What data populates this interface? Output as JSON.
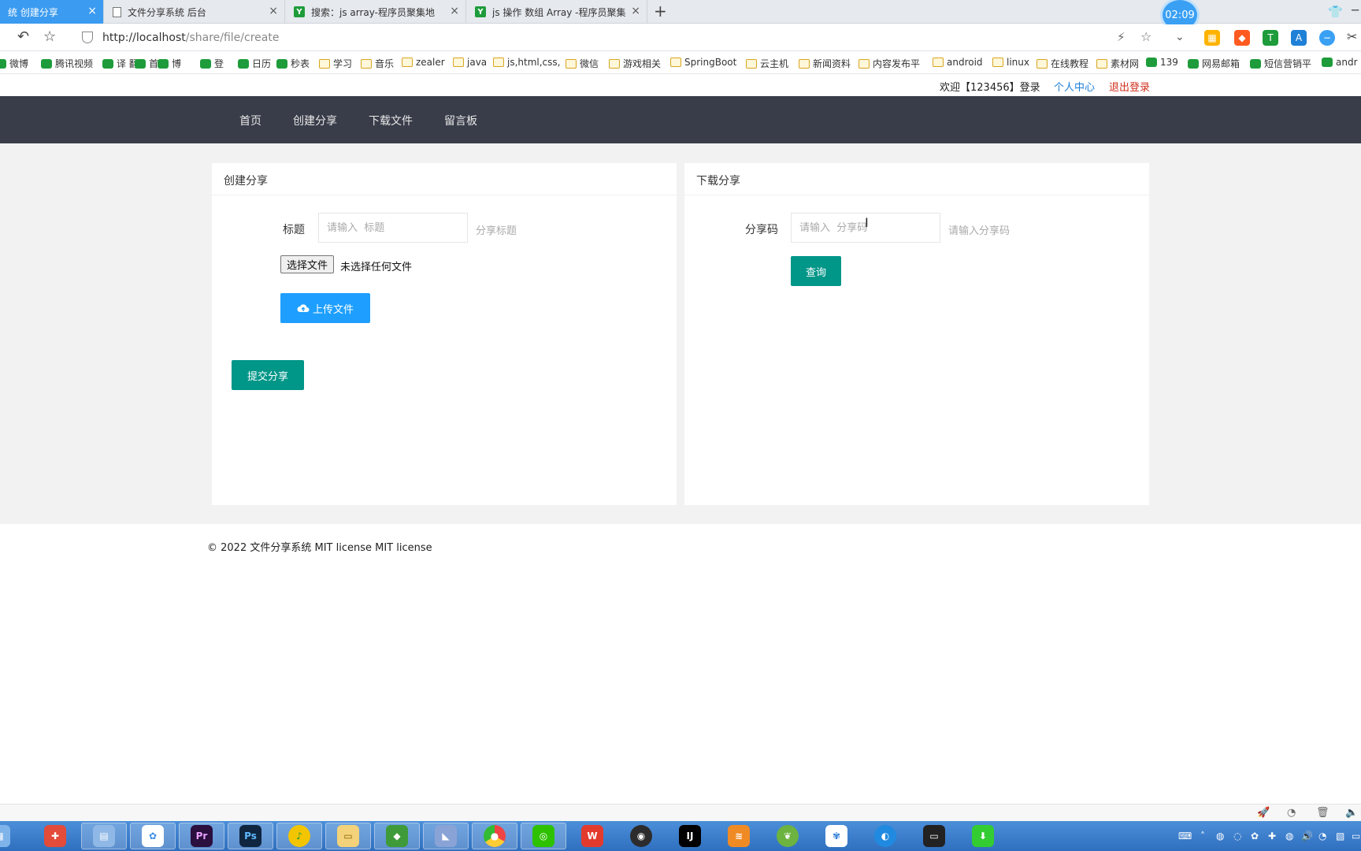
{
  "browser": {
    "tabs": [
      {
        "label": "统 创建分享",
        "active": true,
        "icon": "none"
      },
      {
        "label": "文件分享系统 后台",
        "active": false,
        "icon": "doc"
      },
      {
        "label": "搜索：js array-程序员聚集地",
        "active": false,
        "icon": "y"
      },
      {
        "label": "js 操作 数组 Array -程序员聚集地",
        "active": false,
        "icon": "y"
      }
    ],
    "clock": "02:09",
    "url_host": "http://localhost",
    "url_path": "/share/file/create",
    "bookmarks": [
      {
        "label": "微博",
        "type": "site"
      },
      {
        "label": "腾讯视频",
        "type": "site"
      },
      {
        "label": "译 翻",
        "type": "site"
      },
      {
        "label": "首",
        "type": "site"
      },
      {
        "label": "博",
        "type": "site"
      },
      {
        "label": "登",
        "type": "site"
      },
      {
        "label": "日历",
        "type": "site"
      },
      {
        "label": "秒表",
        "type": "site"
      },
      {
        "label": "学习",
        "type": "folder"
      },
      {
        "label": "音乐",
        "type": "folder"
      },
      {
        "label": "zealer",
        "type": "folder"
      },
      {
        "label": "java",
        "type": "folder"
      },
      {
        "label": "js,html,css,",
        "type": "folder"
      },
      {
        "label": "微信",
        "type": "folder"
      },
      {
        "label": "游戏相关",
        "type": "folder"
      },
      {
        "label": "SpringBoot",
        "type": "folder"
      },
      {
        "label": "云主机",
        "type": "folder"
      },
      {
        "label": "新闻资料",
        "type": "folder"
      },
      {
        "label": "内容发布平",
        "type": "folder"
      },
      {
        "label": "android",
        "type": "folder"
      },
      {
        "label": "linux",
        "type": "folder"
      },
      {
        "label": "在线教程",
        "type": "folder"
      },
      {
        "label": "素材网",
        "type": "folder"
      },
      {
        "label": "139",
        "type": "site"
      },
      {
        "label": "网易邮箱",
        "type": "site"
      },
      {
        "label": "短信营销平",
        "type": "site"
      },
      {
        "label": "andr",
        "type": "site"
      }
    ]
  },
  "userbar": {
    "welcome": "欢迎【123456】登录",
    "profile": "个人中心",
    "logout": "退出登录"
  },
  "nav": {
    "items": [
      "首页",
      "创建分享",
      "下载文件",
      "留言板"
    ]
  },
  "create_card": {
    "title": "创建分享",
    "title_label": "标题",
    "title_placeholder": "请输入  标题",
    "title_aux": "分享标题",
    "choose_file": "选择文件",
    "no_file": "未选择任何文件",
    "upload": "上传文件",
    "submit": "提交分享"
  },
  "download_card": {
    "title": "下载分享",
    "code_label": "分享码",
    "code_placeholder": "请输入  分享码",
    "code_aux": "请输入分享码",
    "query": "查询"
  },
  "footer": {
    "copyright": "© 2022 文件分享系统 MIT license MIT license"
  },
  "colors": {
    "nav_bg": "#393d49",
    "primary_blue": "#1e9fff",
    "teal": "#009688",
    "tab_active": "#3b9bf0"
  }
}
